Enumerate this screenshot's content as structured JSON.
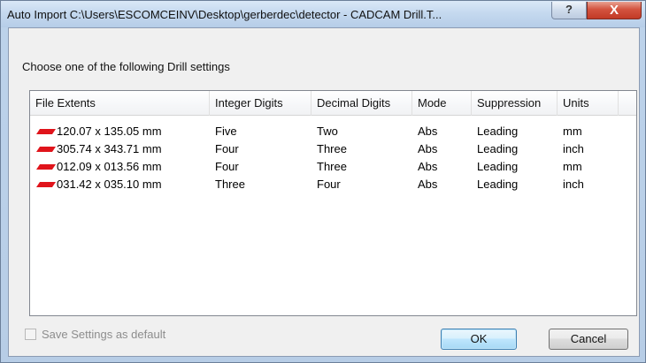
{
  "window": {
    "title": "Auto Import C:\\Users\\ESCOMCEINV\\Desktop\\gerberdec\\detector - CADCAM Drill.T...",
    "help_glyph": "?",
    "close_glyph": "X"
  },
  "instruction": "Choose one of the following Drill settings",
  "table": {
    "columns": [
      "File Extents",
      "Integer Digits",
      "Decimal Digits",
      "Mode",
      "Suppression",
      "Units"
    ],
    "rows": [
      {
        "icon": "drill-layer-icon",
        "extents": "120.07 x 135.05 mm",
        "integer": "Five",
        "decimal": "Two",
        "mode": "Abs",
        "suppression": "Leading",
        "units": "mm"
      },
      {
        "icon": "drill-layer-icon",
        "extents": "305.74 x 343.71 mm",
        "integer": "Four",
        "decimal": "Three",
        "mode": "Abs",
        "suppression": "Leading",
        "units": "inch"
      },
      {
        "icon": "drill-layer-icon",
        "extents": "012.09 x 013.56 mm",
        "integer": "Four",
        "decimal": "Three",
        "mode": "Abs",
        "suppression": "Leading",
        "units": "mm"
      },
      {
        "icon": "drill-layer-icon",
        "extents": "031.42 x 035.10 mm",
        "integer": "Three",
        "decimal": "Four",
        "mode": "Abs",
        "suppression": "Leading",
        "units": "inch"
      }
    ]
  },
  "save_default": {
    "label": "Save Settings as default",
    "checked": false,
    "enabled": false
  },
  "buttons": {
    "ok": "OK",
    "cancel": "Cancel"
  },
  "colors": {
    "icon_red": "#e0141b",
    "close_red": "#c9432f"
  }
}
